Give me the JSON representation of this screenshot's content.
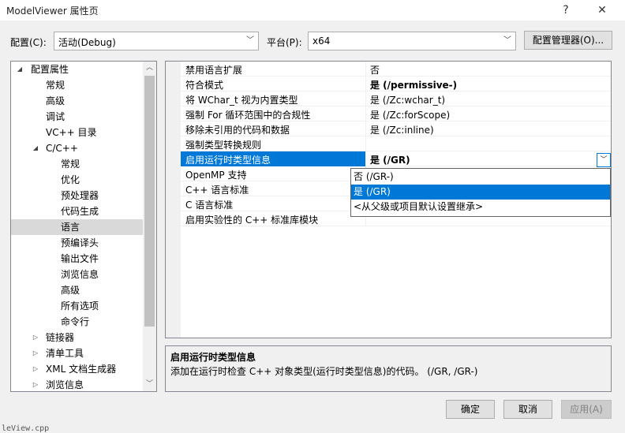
{
  "window": {
    "title": "ModelViewer 属性页",
    "help_label": "?",
    "close_label": "✕"
  },
  "toolbar": {
    "config_label": "配置(C):",
    "config_value": "活动(Debug)",
    "platform_label": "平台(P):",
    "platform_value": "x64",
    "config_manager_label": "配置管理器(O)..."
  },
  "tree": {
    "items": [
      {
        "label": "配置属性",
        "expander": "◢",
        "level": 0
      },
      {
        "label": "常规",
        "level": 1
      },
      {
        "label": "高级",
        "level": 1
      },
      {
        "label": "调试",
        "level": 1
      },
      {
        "label": "VC++ 目录",
        "level": 1
      },
      {
        "label": "C/C++",
        "expander": "◢",
        "level": 1
      },
      {
        "label": "常规",
        "level": 2
      },
      {
        "label": "优化",
        "level": 2
      },
      {
        "label": "预处理器",
        "level": 2
      },
      {
        "label": "代码生成",
        "level": 2
      },
      {
        "label": "语言",
        "level": 2,
        "selected": true
      },
      {
        "label": "预编译头",
        "level": 2
      },
      {
        "label": "输出文件",
        "level": 2
      },
      {
        "label": "浏览信息",
        "level": 2
      },
      {
        "label": "高级",
        "level": 2
      },
      {
        "label": "所有选项",
        "level": 2
      },
      {
        "label": "命令行",
        "level": 2
      },
      {
        "label": "链接器",
        "expander": "▷",
        "level": 1
      },
      {
        "label": "清单工具",
        "expander": "▷",
        "level": 1
      },
      {
        "label": "XML 文档生成器",
        "expander": "▷",
        "level": 1
      },
      {
        "label": "浏览信息",
        "expander": "▷",
        "level": 1
      }
    ]
  },
  "properties": {
    "rows": [
      {
        "name": "禁用语言扩展",
        "value": "否"
      },
      {
        "name": "符合模式",
        "value": "是 (/permissive-)",
        "bold": true
      },
      {
        "name": "将 WChar_t 视为内置类型",
        "value": "是 (/Zc:wchar_t)"
      },
      {
        "name": "强制 For 循环范围中的合规性",
        "value": "是 (/Zc:forScope)"
      },
      {
        "name": "移除未引用的代码和数据",
        "value": "是 (/Zc:inline)"
      },
      {
        "name": "强制类型转换规则",
        "value": ""
      },
      {
        "name": "启用运行时类型信息",
        "value": "是 (/GR)",
        "bold": true,
        "selected": true
      },
      {
        "name": "OpenMP 支持",
        "value": ""
      },
      {
        "name": "C++ 语言标准",
        "value": ""
      },
      {
        "name": "C 语言标准",
        "value": ""
      },
      {
        "name": "启用实验性的 C++ 标准库模块",
        "value": ""
      }
    ]
  },
  "dropdown": {
    "options": [
      {
        "label": "否 (/GR-)"
      },
      {
        "label": "是 (/GR)",
        "selected": true
      },
      {
        "label": "<从父级或项目默认设置继承>"
      }
    ]
  },
  "description": {
    "title": "启用运行时类型信息",
    "text": "添加在运行时检查 C++ 对象类型(运行时类型信息)的代码。     (/GR, /GR-)"
  },
  "buttons": {
    "ok_label": "确定",
    "cancel_label": "取消",
    "apply_label": "应用(A)"
  },
  "background_text": "leView.cpp",
  "colors": {
    "selection": "#0078d7",
    "tree_selection": "#d9d9d9"
  }
}
